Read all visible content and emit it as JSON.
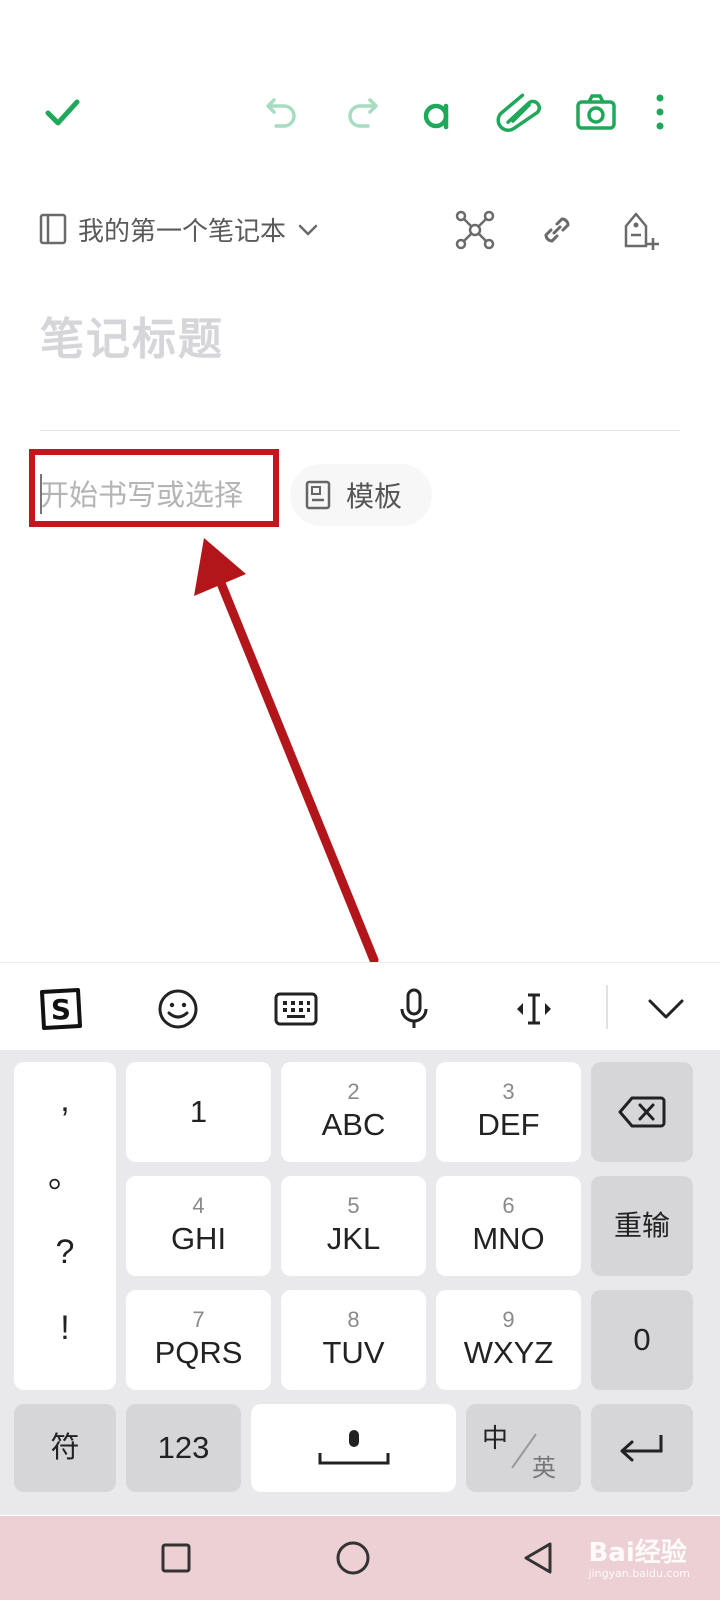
{
  "editor": {
    "notebook_name": "我的第一个笔记本",
    "title_placeholder": "笔记标题",
    "body_placeholder": "开始书写或选择",
    "template_label": "模板",
    "colors": {
      "accent": "#1fa85a",
      "accent_faded": "#a7dcc0",
      "highlight": "#c4161c"
    }
  },
  "toolbar_icons": [
    "check-icon",
    "undo-icon",
    "redo-icon",
    "text-format-icon",
    "paperclip-icon",
    "camera-icon",
    "more-icon"
  ],
  "keyboard": {
    "toolbar_icons": [
      "sogou-logo-icon",
      "emoji-icon",
      "keyboard-icon",
      "microphone-icon",
      "cursor-move-icon",
      "collapse-keyboard-icon"
    ],
    "punctuation": [
      ",",
      "。",
      "?",
      "!"
    ],
    "keys": [
      {
        "num": "",
        "label": "1"
      },
      {
        "num": "2",
        "label": "ABC"
      },
      {
        "num": "3",
        "label": "DEF"
      },
      {
        "num": "4",
        "label": "GHI"
      },
      {
        "num": "5",
        "label": "JKL"
      },
      {
        "num": "6",
        "label": "MNO"
      },
      {
        "num": "7",
        "label": "PQRS"
      },
      {
        "num": "8",
        "label": "TUV"
      },
      {
        "num": "9",
        "label": "WXYZ"
      }
    ],
    "reenter_label": "重输",
    "zero_label": "0",
    "symbols_label": "符",
    "numbers_label": "123",
    "lang_primary": "中",
    "lang_secondary": "英"
  },
  "watermark": {
    "brand": "Bai经验",
    "url": "jingyan.baidu.com"
  }
}
